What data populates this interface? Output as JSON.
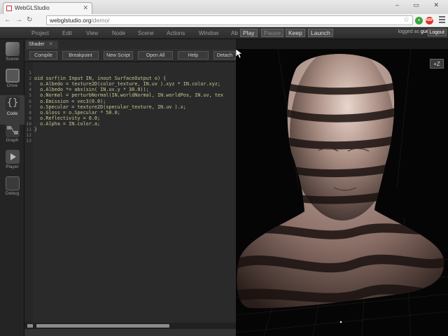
{
  "browser": {
    "tab_title": "WebGLStudio",
    "url_host": "webglstudio.org",
    "url_path": "/demo/",
    "window_controls": "– ▭ ✕",
    "ext_abp": "ABP"
  },
  "menubar": {
    "items": [
      "Project",
      "Edit",
      "View",
      "Node",
      "Scene",
      "Actions",
      "Window",
      "Ab"
    ],
    "run_buttons": [
      "Play",
      "Pause",
      "Keep",
      "Launch"
    ],
    "logged_as_label": "logged as",
    "logged_user": "guest",
    "logout_label": "Logout"
  },
  "sidebar": {
    "items": [
      {
        "label": "Scene",
        "icon": "cube-icon"
      },
      {
        "label": "Drive",
        "icon": "disk-icon"
      },
      {
        "label": "Code",
        "icon": "braces-icon"
      },
      {
        "label": "Graph",
        "icon": "graph-icon"
      },
      {
        "label": "Player",
        "icon": "play-icon"
      },
      {
        "label": "Debug",
        "icon": "document-icon"
      }
    ]
  },
  "panel": {
    "tab_label": "Shader",
    "toolbar": [
      "Compile",
      "Breakpoint",
      "New Script",
      "Open All",
      "Help",
      "Detach"
    ]
  },
  "code": {
    "line_numbers": [
      "1",
      "2",
      "3",
      "4",
      "5",
      "6",
      "7",
      "8",
      "9",
      "10",
      "11",
      "12",
      "13"
    ],
    "lines": [
      "",
      "oid surf(in Input IN, inout SurfaceOutput o) {",
      "  o.Albedo = texture2D(color_texture, IN.uv ).xyz * IN.color.xyz;",
      "  o.Albedo *= abs(sin( IN.uv.y * 30.0));",
      "  o.Normal = perturbNormal(IN.worldNormal, IN.worldPos, IN.uv, tex",
      "  o.Emission = vec3(0.0);",
      "  o.Specular = texture2D(specular_texture, IN.uv ).x;",
      "  o.Gloss = o.Specular * 50.0;",
      "  o.Reflectivity = 0.0;",
      "  o.Alpha = IN.color.a;",
      "}",
      "",
      ""
    ]
  },
  "viewport": {
    "zoom_label": "+Z"
  }
}
